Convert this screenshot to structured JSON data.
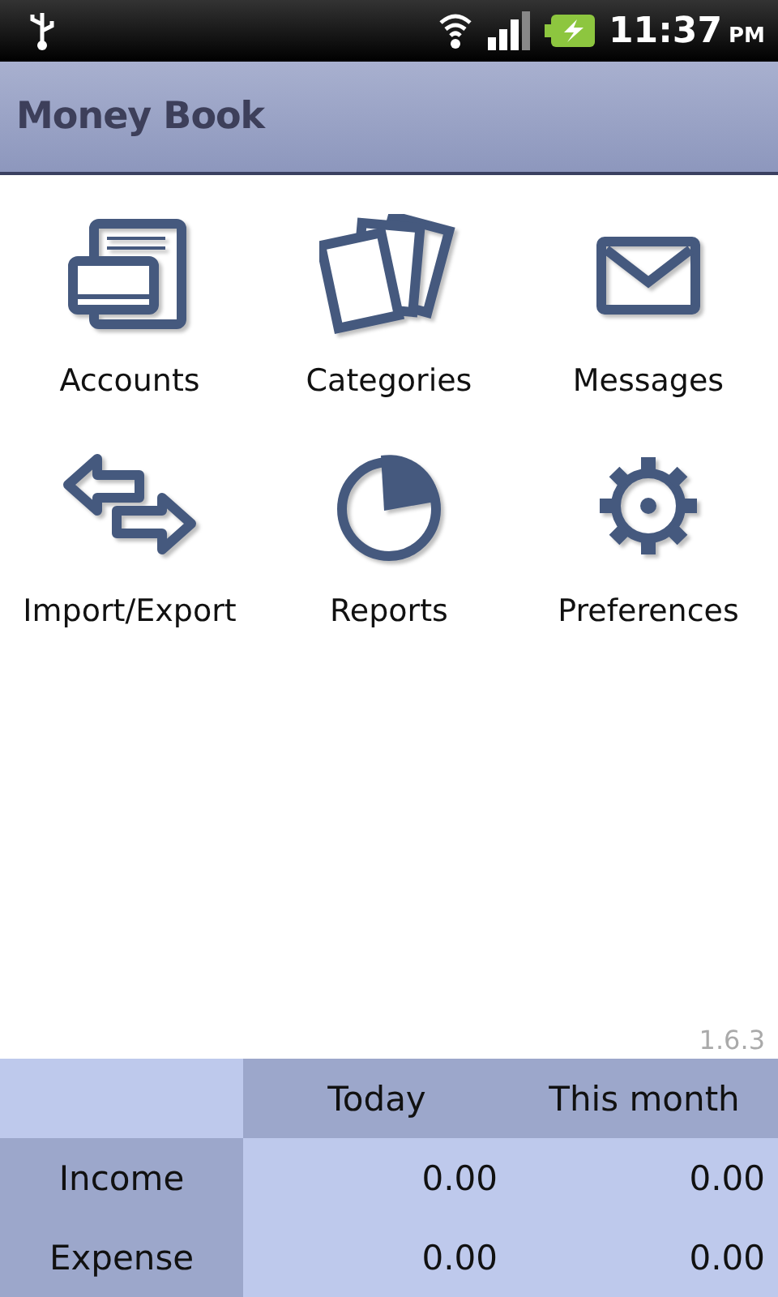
{
  "status_bar": {
    "time": "11:37",
    "period": "PM"
  },
  "app_bar": {
    "title": "Money Book"
  },
  "menu": [
    {
      "label": "Accounts",
      "kind": "accounts"
    },
    {
      "label": "Categories",
      "kind": "categories"
    },
    {
      "label": "Messages",
      "kind": "messages"
    },
    {
      "label": "Import/Export",
      "kind": "transfer"
    },
    {
      "label": "Reports",
      "kind": "reports"
    },
    {
      "label": "Preferences",
      "kind": "preferences"
    }
  ],
  "version": "1.6.3",
  "summary": {
    "columns": [
      "Today",
      "This month"
    ],
    "rows": [
      {
        "label": "Income",
        "values": [
          "0.00",
          "0.00"
        ]
      },
      {
        "label": "Expense",
        "values": [
          "0.00",
          "0.00"
        ]
      }
    ]
  }
}
